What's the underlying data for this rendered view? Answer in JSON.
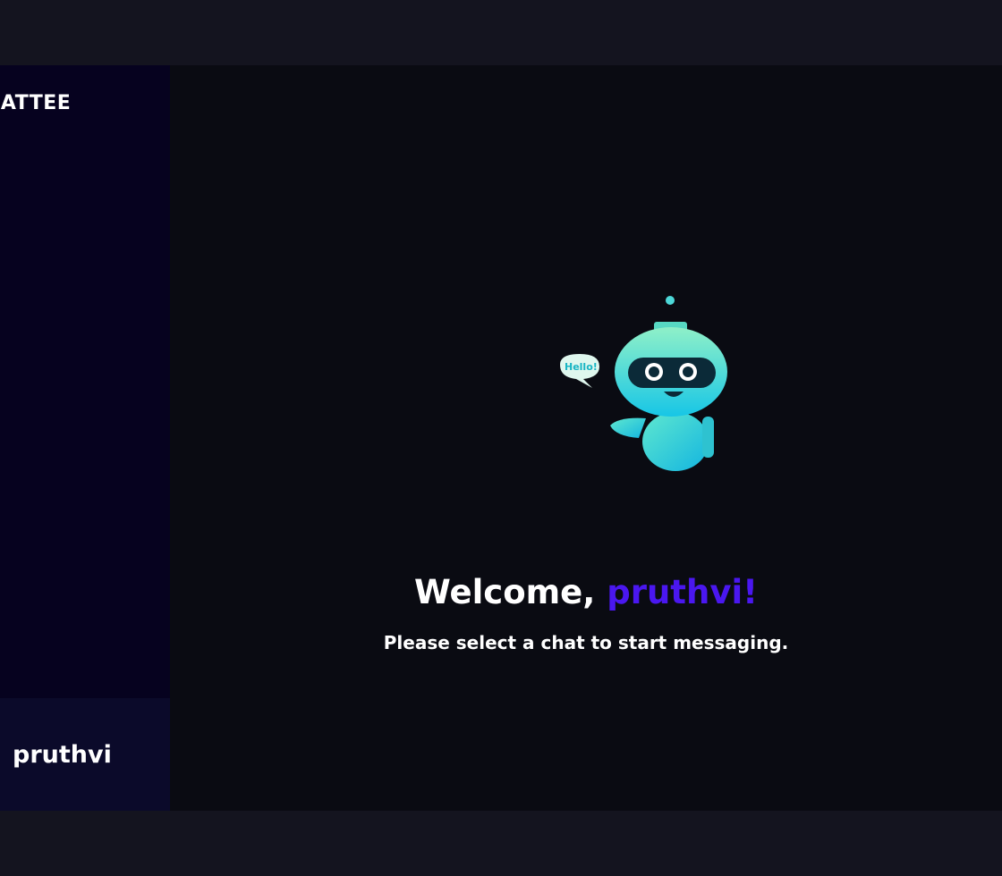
{
  "sidebar": {
    "brand": "HATTEE",
    "user": {
      "name": "pruthvi"
    }
  },
  "main": {
    "welcome_prefix": "Welcome, ",
    "welcome_name": "pruthvi!",
    "subtitle": "Please select a chat to start messaging.",
    "robot": {
      "icon": "robot-mascot-icon",
      "bubble_text": "Hello!"
    }
  },
  "colors": {
    "accent": "#4a17f0",
    "sidebar_bg": "#06021f",
    "main_bg": "#0a0b12",
    "robot_primary": "#3fe0c0"
  }
}
